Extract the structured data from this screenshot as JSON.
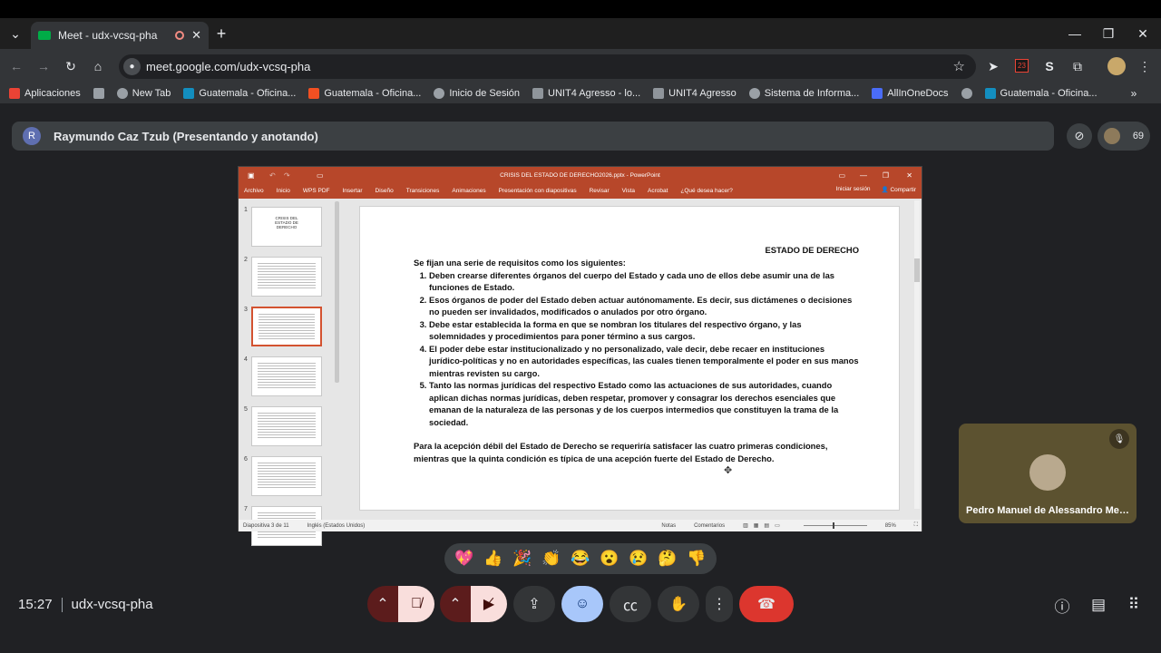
{
  "browser": {
    "tab_title": "Meet - udx-vcsq-pha",
    "url": "meet.google.com/udx-vcsq-pha",
    "bookmarks": [
      {
        "label": "Aplicaciones",
        "icon": "apps-grid-icon"
      },
      {
        "label": "",
        "icon": "grid-icon"
      },
      {
        "label": "New Tab",
        "icon": "globe-icon"
      },
      {
        "label": "Guatemala - Oficina...",
        "icon": "sharepoint-icon"
      },
      {
        "label": "Guatemala - Oficina...",
        "icon": "microsoft-icon"
      },
      {
        "label": "Inicio de Sesión",
        "icon": "globe-icon"
      },
      {
        "label": "UNIT4 Agresso - lo...",
        "icon": "unit4-icon"
      },
      {
        "label": "UNIT4 Agresso",
        "icon": "unit4-icon"
      },
      {
        "label": "Sistema de Informa...",
        "icon": "globe-icon"
      },
      {
        "label": "AllInOneDocs",
        "icon": "docs-icon"
      },
      {
        "label": "",
        "icon": "globe-icon"
      },
      {
        "label": "Guatemala - Oficina...",
        "icon": "sharepoint-icon"
      }
    ],
    "extension_badge": "23"
  },
  "meet": {
    "presenter_initial": "R",
    "presenter_label": "Raymundo Caz Tzub (Presentando y anotando)",
    "participant_count": "69",
    "tile_name": "Pedro Manuel de Alessandro Men...",
    "time": "15:27",
    "meeting_code": "udx-vcsq-pha",
    "reactions": [
      "💖",
      "👍",
      "🎉",
      "👏",
      "😂",
      "😮",
      "😢",
      "🤔",
      "👎"
    ]
  },
  "ppt": {
    "window_title": "CRISIS DEL ESTADO DE DERECHO2026.pptx - PowerPoint",
    "ribbon": [
      "Archivo",
      "Inicio",
      "WPS PDF",
      "Insertar",
      "Diseño",
      "Transiciones",
      "Animaciones",
      "Presentación con diapositivas",
      "Revisar",
      "Vista",
      "Acrobat",
      "¿Qué desea hacer?"
    ],
    "signin": "Iniciar sesión",
    "share": "Compartir",
    "thumb1_title": "CRISIS DEL ESTADO DE DERECHO",
    "thumb_numbers": [
      "1",
      "2",
      "3",
      "4",
      "5",
      "6",
      "7"
    ],
    "status_slide": "Diapositiva 3 de 11",
    "status_lang": "Inglés (Estados Unidos)",
    "status_notes": "Notas",
    "status_comments": "Comentarios",
    "zoom": "85%",
    "slide": {
      "heading": "ESTADO DE DERECHO",
      "intro": "Se fijan una serie de requisitos como los siguientes:",
      "items": [
        "Deben crearse diferentes órganos del cuerpo del Estado y cada uno de ellos debe asumir una de las funciones de Estado.",
        "Esos órganos de poder del Estado deben actuar autónomamente. Es decir, sus dictámenes o decisiones no pueden ser invalidados, modificados o anulados por otro órgano.",
        "Debe estar establecida la forma en que se nombran los titulares del respectivo órgano, y las solemnidades y procedimientos para poner término a sus cargos.",
        "El poder debe estar institucionalizado y no personalizado, vale decir, debe recaer en instituciones jurídico-políticas y no en autoridades específicas, las cuales tienen temporalmente el poder en sus manos mientras revisten su cargo.",
        "Tanto las normas jurídicas del respectivo Estado como las actuaciones de sus autoridades, cuando aplican dichas normas jurídicas, deben respetar, promover y consagrar los derechos esenciales que emanan de la naturaleza de las personas y de los cuerpos intermedios que constituyen la trama de la sociedad."
      ],
      "closing": "Para la acepción débil del Estado de Derecho se requeriría satisfacer las cuatro primeras condiciones, mientras que la quinta condición es típica de una acepción fuerte del Estado de Derecho."
    }
  }
}
